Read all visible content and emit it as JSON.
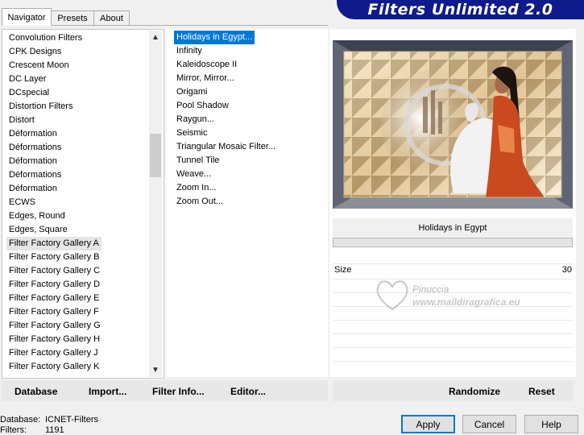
{
  "tabs": [
    {
      "label": "Navigator",
      "active": true
    },
    {
      "label": "Presets",
      "active": false
    },
    {
      "label": "About",
      "active": false
    }
  ],
  "banner": {
    "title": "Filters Unlimited 2.0"
  },
  "categories": {
    "items": [
      "Convolution Filters",
      "CPK Designs",
      "Crescent Moon",
      "DC Layer",
      "DCspecial",
      "Distortion Filters",
      "Distort",
      "Déformation",
      "Déformations",
      "Déformation",
      "Déformations",
      "Déformation",
      "ECWS",
      "Edges, Round",
      "Edges, Square",
      "Filter Factory Gallery A",
      "Filter Factory Gallery B",
      "Filter Factory Gallery C",
      "Filter Factory Gallery D",
      "Filter Factory Gallery E",
      "Filter Factory Gallery F",
      "Filter Factory Gallery G",
      "Filter Factory Gallery H",
      "Filter Factory Gallery J",
      "Filter Factory Gallery K"
    ],
    "selected_index": 15
  },
  "filters": {
    "items": [
      "Holidays in Egypt...",
      "Infinity",
      "Kaleidoscope II",
      "Mirror, Mirror...",
      "Origami",
      "Pool Shadow",
      "Raygun...",
      "Seismic",
      "Triangular Mosaic Filter...",
      "Tunnel Tile",
      "Weave...",
      "Zoom In...",
      "Zoom Out..."
    ],
    "selected_index": 0
  },
  "preview": {
    "filter_name": "Holidays in Egypt"
  },
  "params": [
    {
      "label": "Size",
      "value": "30"
    }
  ],
  "watermark": {
    "name": "Pinuccia",
    "url": "www.maildiragrafica.eu"
  },
  "bottom_links": {
    "database": "Database",
    "import": "Import...",
    "filter_info": "Filter Info...",
    "editor": "Editor...",
    "randomize": "Randomize",
    "reset": "Reset"
  },
  "status": {
    "database_label": "Database:",
    "database_value": "ICNET-Filters",
    "filters_label": "Filters:",
    "filters_value": "1191"
  },
  "buttons": {
    "apply": "Apply",
    "cancel": "Cancel",
    "help": "Help"
  },
  "colors": {
    "selection": "#0078d7",
    "banner": "#0f1a8c"
  }
}
